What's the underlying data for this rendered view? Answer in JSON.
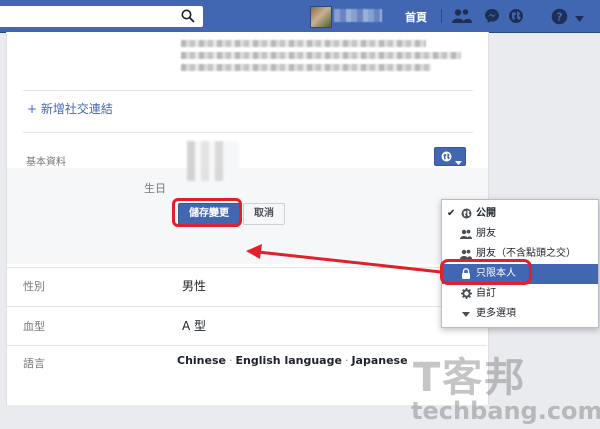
{
  "topbar": {
    "search_placeholder": "",
    "home_label": "首頁",
    "icons": [
      "search-icon",
      "friends-icon",
      "messenger-icon",
      "globe-icon",
      "help-icon",
      "caret-down-icon"
    ]
  },
  "profile": {
    "add_social_link": "+ 新增社交連結",
    "section_title": "基本資料",
    "birthday_label": "生日",
    "save_label": "儲存變更",
    "cancel_label": "取消",
    "gender_label": "性別",
    "gender_value": "男性",
    "blood_label": "血型",
    "blood_value": "A 型",
    "language_label": "語言",
    "languages": [
      "Chinese",
      "English language",
      "Japanese"
    ]
  },
  "privacy_menu": {
    "items": [
      {
        "label": "公開",
        "icon": "globe-icon",
        "selected": true,
        "active": false
      },
      {
        "label": "朋友",
        "icon": "friends-icon",
        "selected": false,
        "active": false
      },
      {
        "label": "朋友（不含點頭之交）",
        "icon": "friends-icon",
        "selected": false,
        "active": false
      },
      {
        "label": "只限本人",
        "icon": "lock-icon",
        "selected": false,
        "active": true
      },
      {
        "label": "自訂",
        "icon": "gear-icon",
        "selected": false,
        "active": false
      },
      {
        "label": "更多選項",
        "icon": "caret-down-icon",
        "selected": false,
        "active": false
      }
    ]
  },
  "watermark": {
    "big": "T客邦",
    "small": "techbang.com"
  },
  "colors": {
    "brand": "#4267b2",
    "highlight": "#e0202a",
    "background": "#e9ebee"
  }
}
